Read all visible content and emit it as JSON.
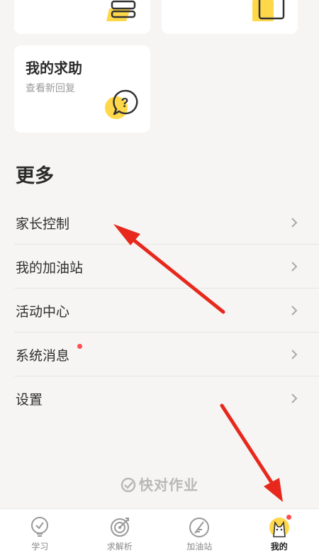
{
  "cards": {
    "help": {
      "title": "我的求助",
      "subtitle": "查看新回复"
    }
  },
  "more": {
    "title": "更多",
    "items": [
      {
        "label": "家长控制"
      },
      {
        "label": "我的加油站"
      },
      {
        "label": "活动中心"
      },
      {
        "label": "系统消息",
        "has_badge": true
      },
      {
        "label": "设置"
      }
    ]
  },
  "brand": {
    "text": "快对作业"
  },
  "tabbar": {
    "tabs": [
      {
        "label": "学习",
        "icon": "lightbulb-icon"
      },
      {
        "label": "求解析",
        "icon": "target-icon"
      },
      {
        "label": "加油站",
        "icon": "feather-icon"
      },
      {
        "label": "我的",
        "icon": "avatar-icon",
        "active": true,
        "has_badge": true
      }
    ]
  },
  "colors": {
    "accent_yellow": "#ffd84a",
    "badge_red": "#ff4d4d",
    "annotation_red": "#e8281c",
    "background": "#f6f5f3"
  }
}
